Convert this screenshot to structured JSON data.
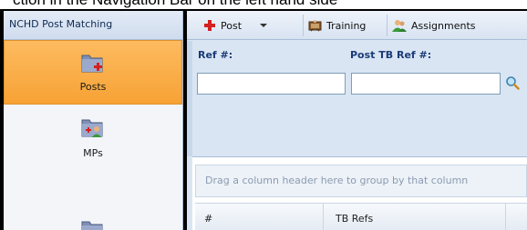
{
  "top_caption": "ction in the Navigation Bar on the left hand side",
  "nav": {
    "header": "NCHD Post Matching",
    "items": [
      {
        "label": "Posts",
        "selected": true
      },
      {
        "label": "MPs",
        "selected": false
      },
      {
        "label": "",
        "selected": false
      }
    ]
  },
  "toolbar": {
    "post_label": "Post",
    "training_label": "Training",
    "assignments_label": "Assignments"
  },
  "search": {
    "ref_label": "Ref #:",
    "ref_value": "",
    "post_tb_ref_label": "Post TB Ref #:",
    "post_tb_ref_value": ""
  },
  "grid": {
    "group_hint": "Drag a column header here to group by that column",
    "columns": [
      "#",
      "TB Refs"
    ]
  },
  "colors": {
    "selected_nav": "#f7a235",
    "label_blue": "#1b3b77",
    "panel_bg": "#d9e5f3"
  }
}
